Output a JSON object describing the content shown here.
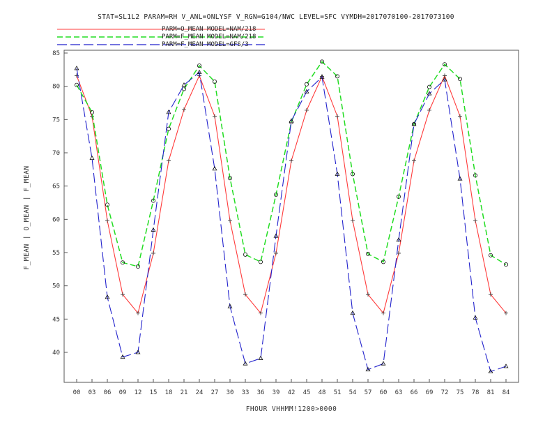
{
  "title": "STAT=SL1L2 PARAM=RH V_ANL=ONLYSF V_RGN=G104/NWC LEVEL=SFC VYMDH=2017070100-2017073100",
  "legend": [
    {
      "label": "PARM=O_MEAN MODEL=NAM/218",
      "color": "#ff3b3b",
      "dash": "solid",
      "marker": "plus"
    },
    {
      "label": "PARM=F_MEAN MODEL=NAM/218",
      "color": "#22dd22",
      "dash": "dashed",
      "marker": "circle-open"
    },
    {
      "label": "PARM=F_MEAN MODEL=GFS/3",
      "color": "#2222cc",
      "dash": "longdash",
      "marker": "triangle"
    }
  ],
  "chart_data": {
    "type": "line",
    "title": "STAT=SL1L2 PARAM=RH V_ANL=ONLYSF V_RGN=G104/NWC LEVEL=SFC VYMDH=2017070100-2017073100",
    "xlabel": "FHOUR VHHMM!1200>0000",
    "ylabel": "F_MEAN | O_MEAN | F_MEAN",
    "categories": [
      "00",
      "03",
      "06",
      "09",
      "12",
      "15",
      "18",
      "21",
      "24",
      "27",
      "30",
      "33",
      "36",
      "39",
      "42",
      "45",
      "48",
      "51",
      "54",
      "57",
      "60",
      "63",
      "66",
      "69",
      "72",
      "75",
      "78",
      "81",
      "84"
    ],
    "ylim": [
      35,
      85
    ],
    "yticks": [
      40,
      45,
      50,
      55,
      60,
      65,
      70,
      75,
      80,
      85
    ],
    "grid": false,
    "legend_position": "top-left",
    "series": [
      {
        "name": "PARM=O_MEAN MODEL=NAM/218",
        "values": [
          81.6,
          75.5,
          59.8,
          48.7,
          45.9,
          54.9,
          68.8,
          76.5,
          81.6,
          75.5,
          59.8,
          48.7,
          45.9,
          54.9,
          68.8,
          76.4,
          81.5,
          75.5,
          59.8,
          48.7,
          45.9,
          54.9,
          68.8,
          76.4,
          81.6,
          75.5,
          59.8,
          48.7,
          45.9
        ]
      },
      {
        "name": "PARM=F_MEAN MODEL=NAM/218",
        "values": [
          80.2,
          76.1,
          62.2,
          53.5,
          52.9,
          62.8,
          73.6,
          79.6,
          83.1,
          80.7,
          66.2,
          54.7,
          53.6,
          63.7,
          74.6,
          80.3,
          83.7,
          81.5,
          66.8,
          54.8,
          53.6,
          63.4,
          74.3,
          79.9,
          83.3,
          81.1,
          66.6,
          54.6,
          53.2
        ]
      },
      {
        "name": "PARM=F_MEAN MODEL=GFS/3",
        "values": [
          82.7,
          69.2,
          48.3,
          39.3,
          40.0,
          58.4,
          76.1,
          80.2,
          82.1,
          67.6,
          46.9,
          38.3,
          39.1,
          57.5,
          74.8,
          79.2,
          81.4,
          66.8,
          45.9,
          37.4,
          38.3,
          56.9,
          74.3,
          78.9,
          81.0,
          66.1,
          45.2,
          37.1,
          37.9
        ]
      }
    ]
  }
}
